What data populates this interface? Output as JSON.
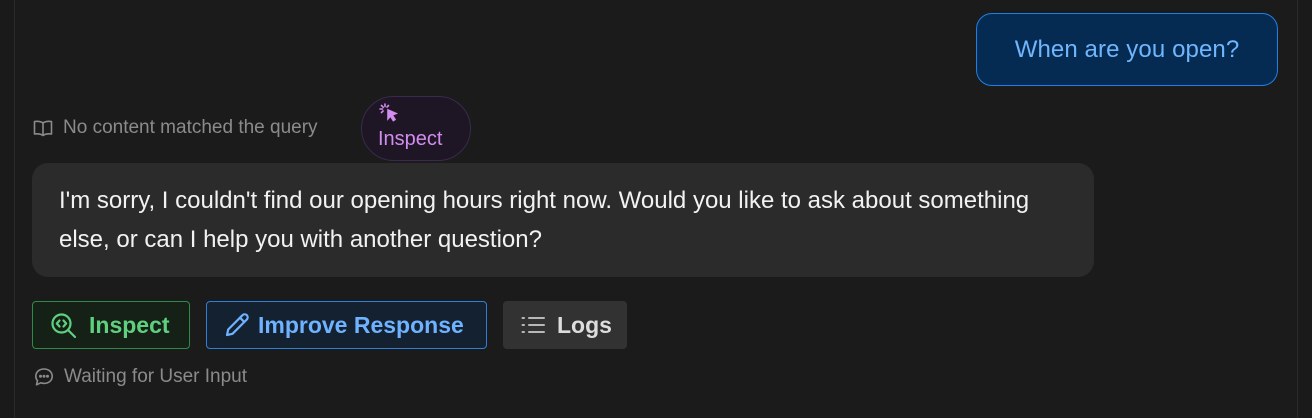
{
  "conversation": {
    "user_message": "When are you open?",
    "source_status": {
      "icon": "book-open-icon",
      "text": "No content matched the query"
    },
    "inspect_pill": {
      "icon": "sparkle-cursor-icon",
      "label": "Inspect",
      "color": "#d38cf0"
    },
    "bot_message": "I'm sorry, I couldn't find our opening hours right now. Would you like to ask about something else, or can I help you with another question?"
  },
  "actions": {
    "inspect": {
      "icon": "magnifier-code-icon",
      "label": "Inspect",
      "color": "#5fd07d"
    },
    "improve": {
      "icon": "pencil-icon",
      "label": "Improve Response",
      "color": "#6fb2ff"
    },
    "logs": {
      "icon": "list-icon",
      "label": "Logs"
    }
  },
  "status": {
    "icon": "chat-bubble-icon",
    "text": "Waiting for User Input"
  },
  "colors": {
    "background": "#1b1b1b",
    "user_bubble_bg": "#062b52",
    "user_bubble_border": "#1e80e6",
    "bot_bubble_bg": "#2b2b2b"
  }
}
